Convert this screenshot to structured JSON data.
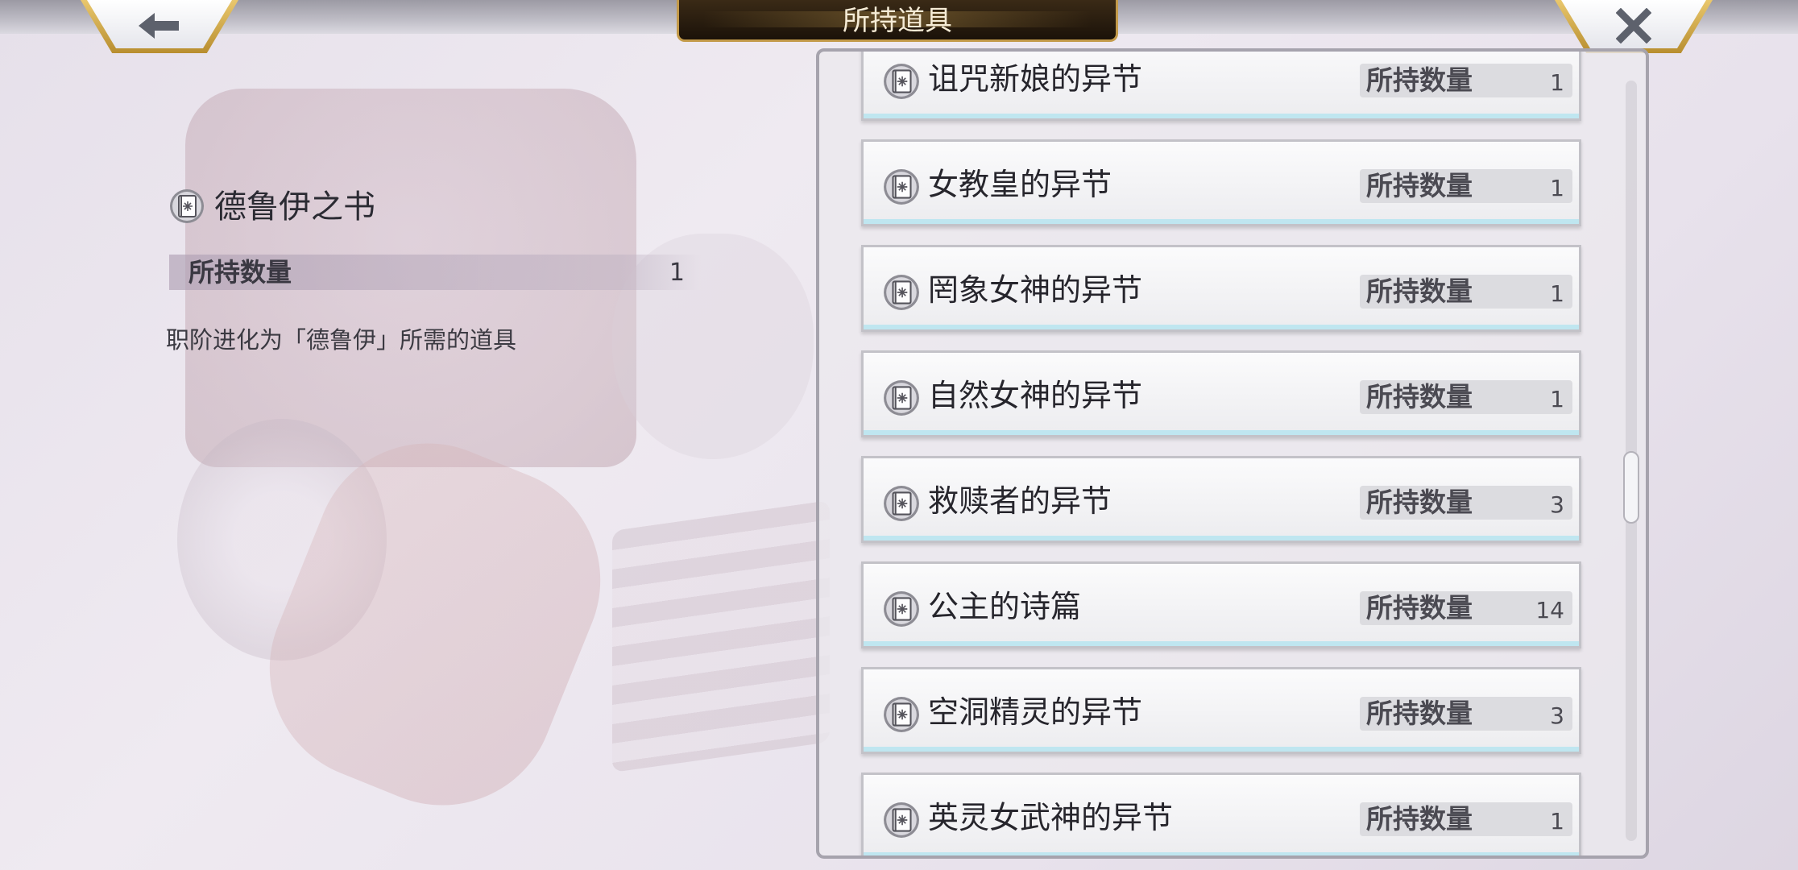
{
  "header": {
    "title": "所持道具",
    "back_icon": "arrow-left-icon",
    "close_icon": "close-icon"
  },
  "detail": {
    "name": "德鲁伊之书",
    "count_label": "所持数量",
    "count": "1",
    "description": "职阶进化为「德鲁伊」所需的道具",
    "icon": "book-icon"
  },
  "items": [
    {
      "name": "诅咒新娘的异节",
      "count_label": "所持数量",
      "count": "1"
    },
    {
      "name": "女教皇的异节",
      "count_label": "所持数量",
      "count": "1"
    },
    {
      "name": "罔象女神的异节",
      "count_label": "所持数量",
      "count": "1"
    },
    {
      "name": "自然女神的异节",
      "count_label": "所持数量",
      "count": "1"
    },
    {
      "name": "救赎者的异节",
      "count_label": "所持数量",
      "count": "3"
    },
    {
      "name": "公主的诗篇",
      "count_label": "所持数量",
      "count": "14"
    },
    {
      "name": "空洞精灵的异节",
      "count_label": "所持数量",
      "count": "3"
    },
    {
      "name": "英灵女武神的异节",
      "count_label": "所持数量",
      "count": "1"
    }
  ],
  "colors": {
    "title_bg": "#1b1209",
    "title_text": "#f6ecd6",
    "gold": "#c39a4a",
    "row_glow": "#bfe6f0"
  }
}
